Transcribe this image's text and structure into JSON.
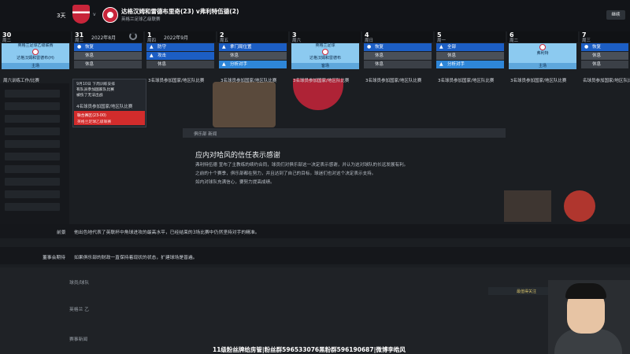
{
  "topbar": {
    "days_left": "3天",
    "vs": "v",
    "match_title": "达格汉姆和雷德布里奇(23) v弗利特伍德(2)",
    "match_sub": "英格兰足球乙级联赛",
    "continue_label": "继续"
  },
  "days": [
    {
      "num": "30",
      "wd": "周二",
      "mo": "",
      "label": "周六训练工作/比赛"
    },
    {
      "num": "31",
      "wd": "周三",
      "mo": "2022年8月",
      "label": "",
      "items": [
        {
          "icon": "●",
          "text": "恢复",
          "style": "blue"
        },
        {
          "icon": "",
          "text": "休息",
          "style": "grey"
        },
        {
          "icon": "",
          "text": "休息",
          "style": "dgrey"
        }
      ]
    },
    {
      "num": "1",
      "wd": "周四",
      "mo": "2022年9月",
      "label": "3名球员参加国家/地区队比赛",
      "items": [
        {
          "icon": "▲",
          "text": "防守",
          "style": "blue"
        },
        {
          "icon": "▲",
          "text": "攻击",
          "style": "blue"
        },
        {
          "icon": "",
          "text": "休息",
          "style": "dgrey"
        }
      ]
    },
    {
      "num": "2",
      "wd": "周五",
      "mo": "",
      "label": "3名球员参加国家/地区队比赛",
      "items": [
        {
          "icon": "▲",
          "text": "拿门局位置",
          "style": "blue"
        },
        {
          "icon": "",
          "text": "休息",
          "style": "grey"
        },
        {
          "icon": "▲",
          "text": "分析对手",
          "style": "lblue"
        }
      ]
    },
    {
      "num": "3",
      "wd": "周六",
      "mo": "",
      "label": "3名球员参加国家/地区队比赛",
      "match": {
        "line1": "英格兰足球",
        "line2": "达格汉姆和雷德布",
        "venue": "客场"
      }
    },
    {
      "num": "4",
      "wd": "周日",
      "mo": "",
      "label": "3名球员参加国家/地区队比赛",
      "items": [
        {
          "icon": "●",
          "text": "恢复",
          "style": "blue"
        },
        {
          "icon": "",
          "text": "休息",
          "style": "grey"
        },
        {
          "icon": "",
          "text": "休息",
          "style": "dgrey"
        }
      ]
    },
    {
      "num": "5",
      "wd": "周一",
      "mo": "",
      "label": "3名球员参加国家/地区队比赛",
      "items": [
        {
          "icon": "▲",
          "text": "全部",
          "style": "blue"
        },
        {
          "icon": "",
          "text": "休息",
          "style": "grey"
        },
        {
          "icon": "▲",
          "text": "分析对手",
          "style": "lblue"
        }
      ]
    },
    {
      "num": "6",
      "wd": "周二",
      "mo": "",
      "label": "3名球员参加国家/地区队比赛",
      "match": {
        "line1": "",
        "line2": "弗利特",
        "venue": "主场"
      }
    },
    {
      "num": "7",
      "wd": "周三",
      "mo": "",
      "label": "名球员参加国家/地区队比赛",
      "items": [
        {
          "icon": "●",
          "text": "恢复",
          "style": "blue"
        },
        {
          "icon": "",
          "text": "休息",
          "style": "grey"
        },
        {
          "icon": "",
          "text": "休息",
          "style": "dgrey"
        }
      ]
    }
  ],
  "first_match": {
    "line1": "英格兰足球乙级联赛",
    "line2": "达格汉姆和雷德布(H)",
    "venue": "主场"
  },
  "popup": {
    "line1": "9月10日 下周训练安排",
    "line2": "有队员参加国家队比赛",
    "line3": "被伤了无法出战",
    "line4": "4名球员参加国家/地区队比赛",
    "red1": "联合赛区(23-00)",
    "red2": "英格兰足球乙级联赛"
  },
  "article": {
    "strip": "俱乐部 新闻",
    "title": "应内对哈风的信任表示感谢",
    "p1": "弗利特伍德 宣布了主教练的续约合同，球员们对俱乐部这一决定表示感谢，并认为这对球队的长远发展有利。",
    "p2": "之前的十个赛季，俱乐部都在努力，并且达到了自己的目标。球迷们也对这个决定表示支持。",
    "p3": "如内对球队充满信心，要努力提高成绩。"
  },
  "rows": {
    "r1_label": "前景",
    "r1_text": "他出色地代表了英联杯中角球进攻的最高水平，已经结束的3场比赛中仍然坚持对手的精准。",
    "r2_label": "董事会期待",
    "r2_text": "如果俱乐部的财政一直保持着现状的状态，扩建球场是普遍。"
  },
  "bottom": {
    "follow": "最值得关注",
    "banner": "11级粉丝牌给房管|粉丝群596533076黑粉群596190687|微博李皓风",
    "list1": "球员/球队",
    "list2": "英格兰 乙",
    "list3": "赛事新闻"
  }
}
